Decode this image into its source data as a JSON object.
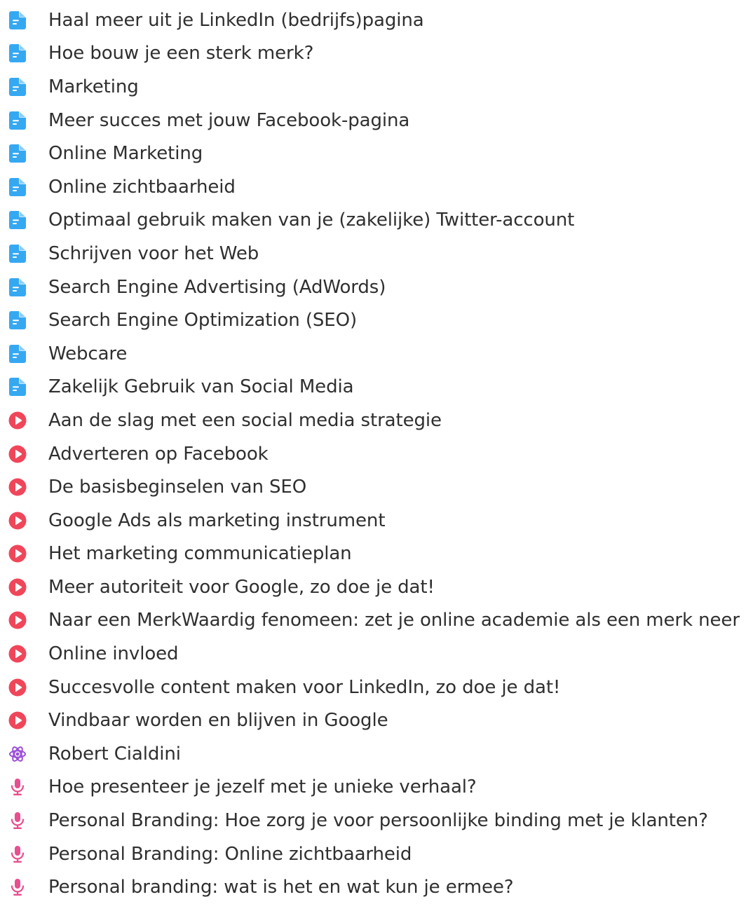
{
  "colors": {
    "document": "#35a8f2",
    "video": "#f0465a",
    "atom": "#9b4dd8",
    "podcast": "#e94e8f"
  },
  "items": [
    {
      "label": "Haal meer uit je LinkedIn (bedrijfs)pagina",
      "icon": "document-icon"
    },
    {
      "label": "Hoe bouw je een sterk merk?",
      "icon": "document-icon"
    },
    {
      "label": "Marketing",
      "icon": "document-icon"
    },
    {
      "label": "Meer succes met jouw Facebook-pagina",
      "icon": "document-icon"
    },
    {
      "label": "Online Marketing",
      "icon": "document-icon"
    },
    {
      "label": "Online zichtbaarheid",
      "icon": "document-icon"
    },
    {
      "label": "Optimaal gebruik maken van je (zakelijke) Twitter-account",
      "icon": "document-icon"
    },
    {
      "label": "Schrijven voor het Web",
      "icon": "document-icon"
    },
    {
      "label": "Search Engine Advertising (AdWords)",
      "icon": "document-icon"
    },
    {
      "label": "Search Engine Optimization (SEO)",
      "icon": "document-icon"
    },
    {
      "label": "Webcare",
      "icon": "document-icon"
    },
    {
      "label": "Zakelijk Gebruik van Social Media",
      "icon": "document-icon"
    },
    {
      "label": "Aan de slag met een social media strategie",
      "icon": "play-video-icon"
    },
    {
      "label": "Adverteren op Facebook",
      "icon": "play-video-icon"
    },
    {
      "label": "De basisbeginselen van SEO",
      "icon": "play-video-icon"
    },
    {
      "label": "Google Ads als marketing instrument",
      "icon": "play-video-icon"
    },
    {
      "label": "Het marketing communicatieplan",
      "icon": "play-video-icon"
    },
    {
      "label": "Meer autoriteit voor Google, zo doe je dat!",
      "icon": "play-video-icon"
    },
    {
      "label": "Naar een MerkWaardig fenomeen: zet je online academie als een merk neer",
      "icon": "play-video-icon"
    },
    {
      "label": "Online invloed",
      "icon": "play-video-icon"
    },
    {
      "label": "Succesvolle content maken voor LinkedIn, zo doe je dat!",
      "icon": "play-video-icon"
    },
    {
      "label": "Vindbaar worden en blijven in Google",
      "icon": "play-video-icon"
    },
    {
      "label": "Robert Cialdini",
      "icon": "atom-icon"
    },
    {
      "label": "Hoe presenteer je jezelf met je unieke verhaal?",
      "icon": "microphone-icon"
    },
    {
      "label": "Personal Branding: Hoe zorg je voor persoonlijke binding met je klanten?",
      "icon": "microphone-icon"
    },
    {
      "label": "Personal Branding: Online zichtbaarheid",
      "icon": "microphone-icon"
    },
    {
      "label": "Personal branding: wat is het en wat kun je ermee?",
      "icon": "microphone-icon"
    }
  ]
}
